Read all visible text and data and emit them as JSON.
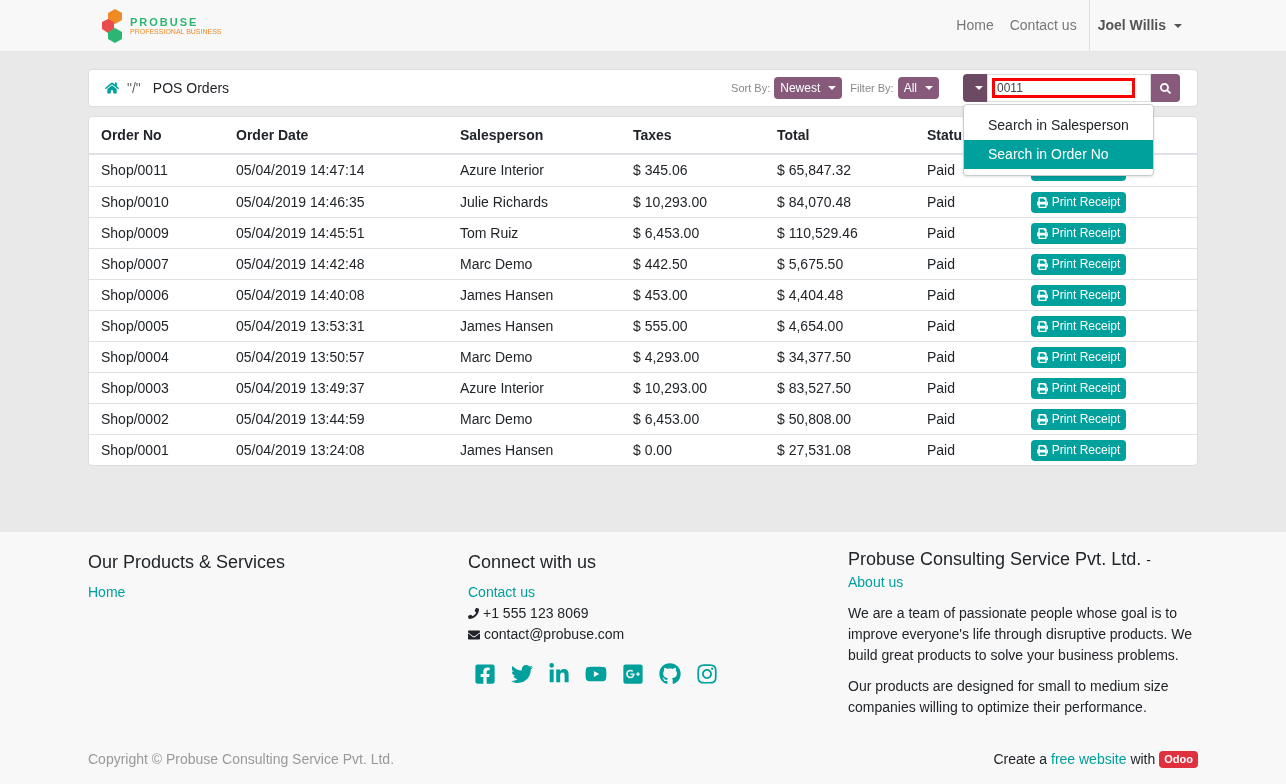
{
  "navbar": {
    "logo_text": "PROBUSE",
    "logo_sub": "PROFESSIONAL BUSINESS",
    "links": [
      "Home",
      "Contact us"
    ],
    "user": "Joel Willis"
  },
  "toolbar": {
    "breadcrumb": "\"/\"",
    "title": "POS Orders",
    "sort_label": "Sort By:",
    "sort_value": "Newest",
    "filter_label": "Filter By:",
    "filter_value": "All",
    "search_value": "0011",
    "search_options": [
      {
        "label": "Search in Salesperson",
        "selected": false
      },
      {
        "label": "Search in Order No",
        "selected": true
      }
    ]
  },
  "table": {
    "columns": [
      "Order No",
      "Order Date",
      "Salesperson",
      "Taxes",
      "Total",
      "Statu"
    ],
    "rows": [
      {
        "cells": [
          "Shop/0011",
          "05/04/2019 14:47:14",
          "Azure Interior",
          "$ 345.06",
          "$ 65,847.32",
          "Paid"
        ]
      },
      {
        "cells": [
          "Shop/0010",
          "05/04/2019 14:46:35",
          "Julie Richards",
          "$ 10,293.00",
          "$ 84,070.48",
          "Paid"
        ],
        "action": "Print Receipt"
      },
      {
        "cells": [
          "Shop/0009",
          "05/04/2019 14:45:51",
          "Tom Ruiz",
          "$ 6,453.00",
          "$ 110,529.46",
          "Paid"
        ],
        "action": "Print Receipt"
      },
      {
        "cells": [
          "Shop/0007",
          "05/04/2019 14:42:48",
          "Marc Demo",
          "$ 442.50",
          "$ 5,675.50",
          "Paid"
        ],
        "action": "Print Receipt"
      },
      {
        "cells": [
          "Shop/0006",
          "05/04/2019 14:40:08",
          "James Hansen",
          "$ 453.00",
          "$ 4,404.48",
          "Paid"
        ],
        "action": "Print Receipt"
      },
      {
        "cells": [
          "Shop/0005",
          "05/04/2019 13:53:31",
          "James Hansen",
          "$ 555.00",
          "$ 4,654.00",
          "Paid"
        ],
        "action": "Print Receipt"
      },
      {
        "cells": [
          "Shop/0004",
          "05/04/2019 13:50:57",
          "Marc Demo",
          "$ 4,293.00",
          "$ 34,377.50",
          "Paid"
        ],
        "action": "Print Receipt"
      },
      {
        "cells": [
          "Shop/0003",
          "05/04/2019 13:49:37",
          "Azure Interior",
          "$ 10,293.00",
          "$ 83,527.50",
          "Paid"
        ],
        "action": "Print Receipt"
      },
      {
        "cells": [
          "Shop/0002",
          "05/04/2019 13:44:59",
          "Marc Demo",
          "$ 6,453.00",
          "$ 50,808.00",
          "Paid"
        ],
        "action": "Print Receipt"
      },
      {
        "cells": [
          "Shop/0001",
          "05/04/2019 13:24:08",
          "James Hansen",
          "$ 0.00",
          "$ 27,531.08",
          "Paid"
        ],
        "action": "Print Receipt"
      }
    ]
  },
  "footer": {
    "products_title": "Our Products & Services",
    "products_links": [
      "Home"
    ],
    "connect_title": "Connect with us",
    "connect_link": "Contact us",
    "phone": "+1 555 123 8069",
    "email": "contact@probuse.com",
    "company_title": "Probuse Consulting Service Pvt. Ltd.",
    "company_sep": "-",
    "company_link": "About us",
    "paragraphs": [
      "We are a team of passionate people whose goal is to improve everyone's life through disruptive products. We build great products to solve your business problems.",
      "Our products are designed for small to medium size companies willing to optimize their performance."
    ],
    "copyright": "Copyright © Probuse Consulting Service Pvt. Ltd.",
    "create_prefix": "Create a",
    "create_link": "free website",
    "create_mid": "with",
    "odoo_badge": "Odoo"
  }
}
